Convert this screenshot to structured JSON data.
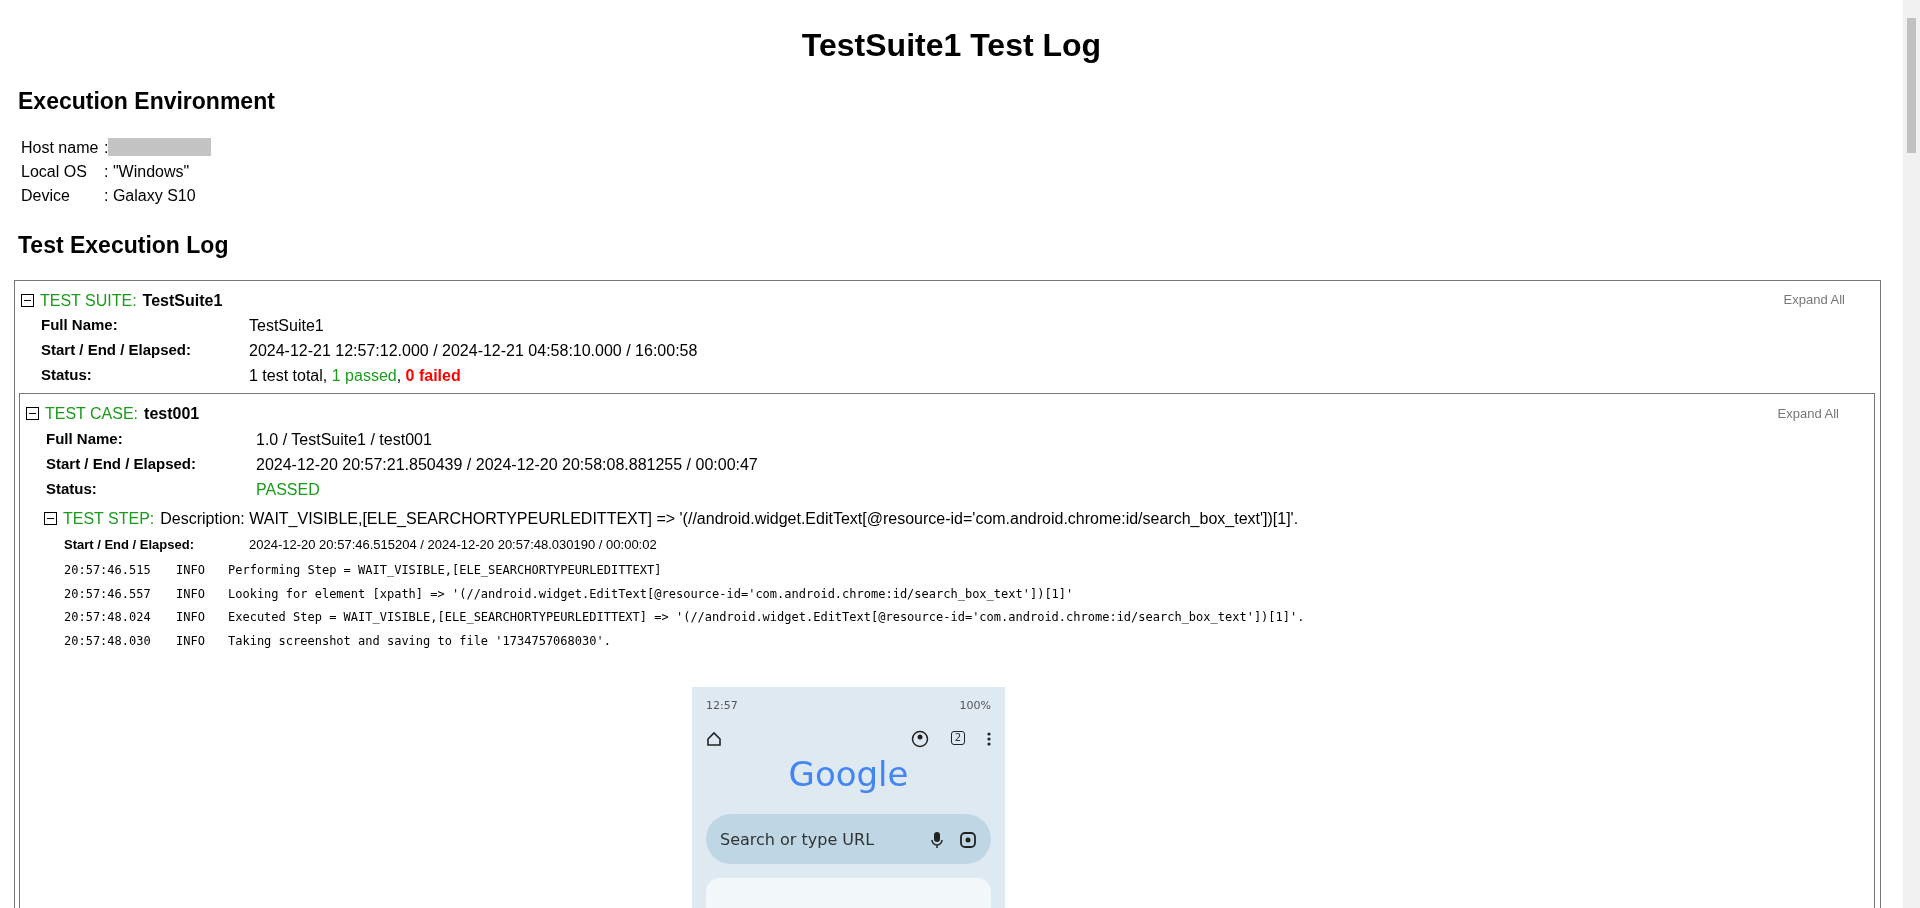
{
  "title": "TestSuite1 Test Log",
  "environment": {
    "heading": "Execution Environment",
    "items": [
      {
        "label": "Host name",
        "value": ":",
        "redacted": true
      },
      {
        "label": "Local OS",
        "value": ": \"Windows\"",
        "redacted": false
      },
      {
        "label": "Device",
        "value": ": Galaxy S10",
        "redacted": false
      }
    ]
  },
  "log_heading": "Test Execution Log",
  "suite": {
    "label": "TEST SUITE:",
    "name": "TestSuite1",
    "expanded": true,
    "expand_all": "Expand All",
    "fields": [
      {
        "label": "Full Name:",
        "parts": [
          {
            "text": "TestSuite1",
            "kind": "plain"
          }
        ]
      },
      {
        "label": "Start / End / Elapsed:",
        "parts": [
          {
            "text": "2024-12-21 12:57:12.000 / 2024-12-21 04:58:10.000 / 16:00:58",
            "kind": "plain"
          }
        ]
      },
      {
        "label": "Status:",
        "parts": [
          {
            "text": "1 test total,",
            "kind": "plain"
          },
          {
            "text": "1 passed",
            "kind": "pass",
            "suffix": ","
          },
          {
            "text": "0 failed",
            "kind": "fail"
          }
        ]
      }
    ],
    "case": {
      "label": "TEST CASE:",
      "name": "test001",
      "expanded": true,
      "expand_all": "Expand All",
      "fields": [
        {
          "label": "Full Name:",
          "parts": [
            {
              "text": "1.0 / TestSuite1 / test001",
              "kind": "plain"
            }
          ]
        },
        {
          "label": "Start / End / Elapsed:",
          "parts": [
            {
              "text": "2024-12-20 20:57:21.850439 / 2024-12-20 20:58:08.881255 / 00:00:47",
              "kind": "plain"
            }
          ]
        },
        {
          "label": "Status:",
          "parts": [
            {
              "text": "PASSED",
              "kind": "pass"
            }
          ]
        }
      ],
      "step": {
        "label": "TEST STEP:",
        "description": "Description: WAIT_VISIBLE,[ELE_SEARCHORTYPEURLEDITTEXT] => '(//android.widget.EditText[@resource-id='com.android.chrome:id/search_box_text'])[1]'.",
        "expanded": true,
        "timing_label": "Start / End / Elapsed:",
        "timing": "2024-12-20 20:57:46.515204 / 2024-12-20 20:57:48.030190 / 00:00:02",
        "logs": [
          {
            "time": "20:57:46.515",
            "level": "INFO",
            "message": "Performing Step = WAIT_VISIBLE,[ELE_SEARCHORTYPEURLEDITTEXT]"
          },
          {
            "time": "20:57:46.557",
            "level": "INFO",
            "message": "Looking for element [xpath] => '(//android.widget.EditText[@resource-id='com.android.chrome:id/search_box_text'])[1]'"
          },
          {
            "time": "20:57:48.024",
            "level": "INFO",
            "message": "Executed Step = WAIT_VISIBLE,[ELE_SEARCHORTYPEURLEDITTEXT] => '(//android.widget.EditText[@resource-id='com.android.chrome:id/search_box_text'])[1]'."
          },
          {
            "time": "20:57:48.030",
            "level": "INFO",
            "message": "Taking screenshot and saving to file '1734757068030'."
          }
        ],
        "screenshot": {
          "clock": "12:57",
          "battery": "100%",
          "tab_count": "2",
          "logo": "Google",
          "search_placeholder": "Search or type URL"
        }
      }
    }
  }
}
